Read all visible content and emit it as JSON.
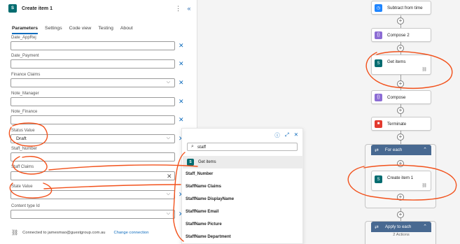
{
  "panel": {
    "title": "Create item 1",
    "app_icon": "sharepoint-icon",
    "icon_text": "S",
    "more_icon": "ellipsis-vertical-icon",
    "collapse_icon": "double-chevron-left-icon",
    "tabs": [
      {
        "label": "Parameters",
        "active": true
      },
      {
        "label": "Settings",
        "active": false
      },
      {
        "label": "Code view",
        "active": false
      },
      {
        "label": "Testing",
        "active": false
      },
      {
        "label": "About",
        "active": false
      }
    ],
    "fields": [
      {
        "label": "Date_AppRej",
        "value": "",
        "type": "text"
      },
      {
        "label": "Date_Payment",
        "value": "",
        "type": "text"
      },
      {
        "label": "Finance Claims",
        "value": "",
        "type": "dropdown"
      },
      {
        "label": "Note_Manager",
        "value": "",
        "type": "text"
      },
      {
        "label": "Note_Finance",
        "value": "",
        "type": "text"
      },
      {
        "label": "Status Value",
        "value": "Draft",
        "type": "dropdown"
      },
      {
        "label": "Staff_Number",
        "value": "",
        "type": "text"
      },
      {
        "label": "Staff Claims",
        "value": "",
        "type": "text"
      },
      {
        "label": "State Value",
        "value": "",
        "type": "dropdown"
      },
      {
        "label": "Content type Id",
        "value": "",
        "type": "dropdown"
      }
    ],
    "connection": {
      "text": "Connected to jamesmao@guestgroup.com.au",
      "change_label": "Change connection"
    }
  },
  "popup": {
    "search_value": "staff",
    "group_label": "Get items",
    "items": [
      "Staff_Number",
      "StaffName Claims",
      "StaffName DisplayName",
      "StaffName Email",
      "StaffName Picture",
      "StaffName Department"
    ],
    "tool_icons": [
      "info-icon",
      "expand-icon",
      "close-icon"
    ]
  },
  "canvas": {
    "actions": [
      {
        "label": "Subtract from time",
        "icon": "clock-icon",
        "color": "#1f85ff"
      },
      {
        "label": "Compose 2",
        "icon": "compose-icon",
        "color": "#8c6cd4"
      },
      {
        "label": "Get items",
        "icon": "sharepoint-icon",
        "color": "#036c70"
      },
      {
        "label": "Compose",
        "icon": "compose-icon",
        "color": "#8c6cd4"
      },
      {
        "label": "Terminate",
        "icon": "terminate-icon",
        "color": "#e33a2f"
      }
    ],
    "for_each_label": "For each",
    "create_item_label": "Create item 1",
    "apply_each_label": "Apply to each",
    "actions_count": "2 Actions"
  },
  "colors": {
    "accent": "#0f6cbd",
    "annotation": "#f2511b",
    "scope": "#486991"
  }
}
